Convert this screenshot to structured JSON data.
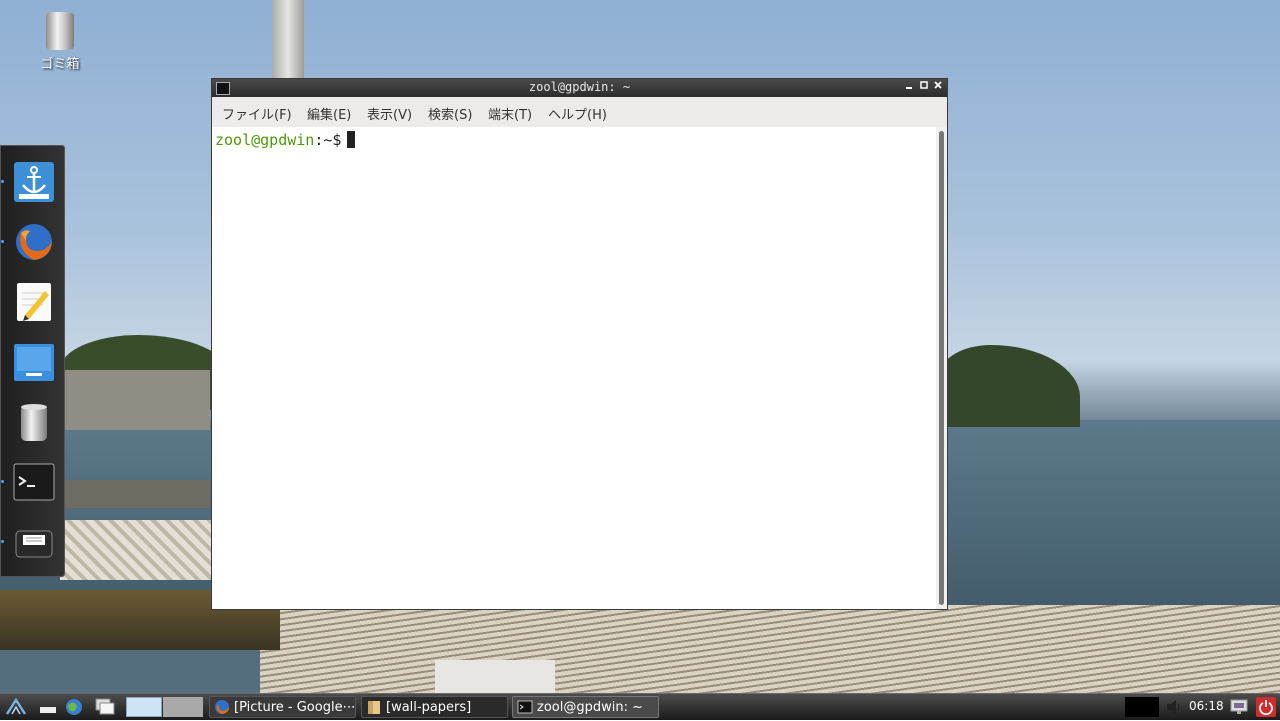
{
  "desktop": {
    "trash_label": "ゴミ箱"
  },
  "dock": {
    "items": [
      {
        "name": "anchor-launcher-icon"
      },
      {
        "name": "firefox-icon"
      },
      {
        "name": "text-editor-icon"
      },
      {
        "name": "window-icon"
      },
      {
        "name": "trash-icon"
      },
      {
        "name": "terminal-icon"
      },
      {
        "name": "printer-icon"
      }
    ]
  },
  "window": {
    "title": "zool@gpdwin: ~",
    "menu": [
      "ファイル(F)",
      "編集(E)",
      "表示(V)",
      "検索(S)",
      "端末(T)",
      "ヘルプ(H)"
    ],
    "prompt_user": "zool@gpdwin",
    "prompt_suffix": ":~$"
  },
  "taskbar": {
    "tasks": [
      "[Picture - Google⋯",
      "[wall-papers]",
      "zool@gpdwin: ~"
    ],
    "clock": "06:18"
  },
  "colors": {
    "prompt_user": "#4e9a06",
    "power_button": "#d22b2b",
    "titlebar": "#2c2c2c",
    "taskbar": "#1b1b1b"
  }
}
